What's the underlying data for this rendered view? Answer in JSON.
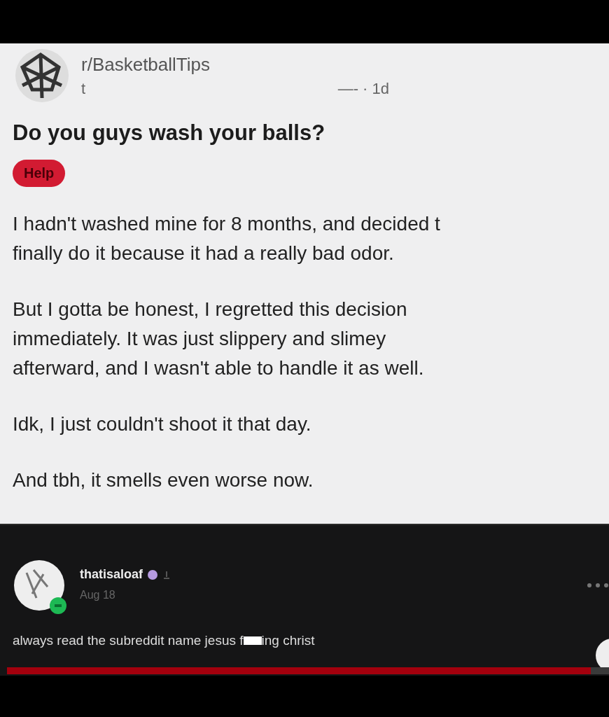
{
  "post": {
    "subreddit": "r/BasketballTips",
    "username": "t",
    "time_separator": "—- · 1d",
    "title": "Do you guys wash your balls?",
    "flair": "Help",
    "paragraphs": [
      [
        "I hadn't washed mine for 8 months, and decided t",
        "finally do it because it had a really bad odor."
      ],
      [
        "But I gotta be honest, I regretted this decision",
        "immediately. It was just slippery and slimey",
        "afterward, and I wasn't able to handle it as well."
      ],
      [
        "Idk, I just couldn't shoot it that day."
      ],
      [
        "And tbh, it smells even worse now."
      ]
    ]
  },
  "video_progress": {
    "level": 0.97
  },
  "comment": {
    "username": "thatisaloaf",
    "date": "Aug 18",
    "text_before": "always read the subreddit name jesus f",
    "text_after": "ing christ"
  }
}
